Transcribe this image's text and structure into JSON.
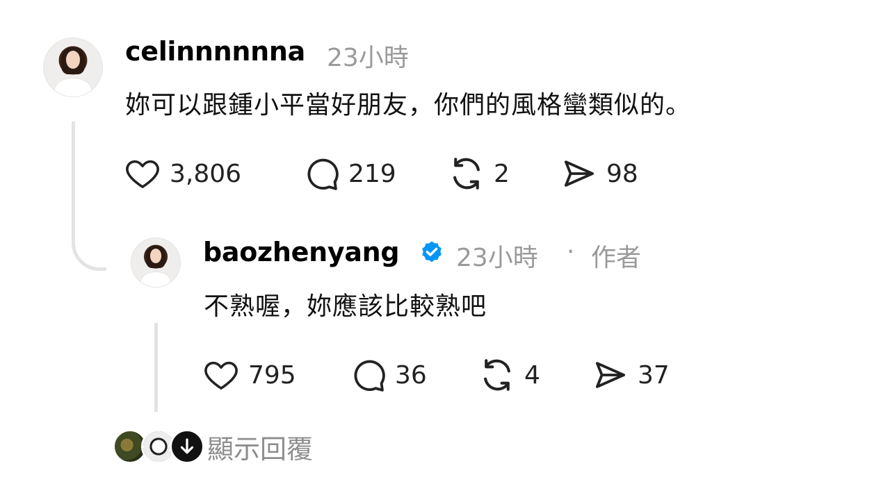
{
  "comment": {
    "username": "celinnnnnna",
    "time": "23小時",
    "text": "妳可以跟鍾小平當好朋友，你們的風格蠻類似的。",
    "actions": {
      "likes": "3,806",
      "replies": "219",
      "reposts": "2",
      "shares": "98"
    }
  },
  "reply": {
    "username": "baozhenyang",
    "time": "23小時",
    "separator": "·",
    "author_tag": "作者",
    "text": "不熟喔，妳應該比較熟吧",
    "actions": {
      "likes": "795",
      "replies": "36",
      "reposts": "4",
      "shares": "37"
    }
  },
  "show_replies": {
    "label": "顯示回覆"
  },
  "colors": {
    "verified": "#0095f6",
    "muted": "#9a9a9a",
    "thread_line": "#e3e3e3"
  },
  "icons": [
    "heart-icon",
    "comment-icon",
    "repost-icon",
    "share-icon",
    "verified-badge-icon"
  ]
}
